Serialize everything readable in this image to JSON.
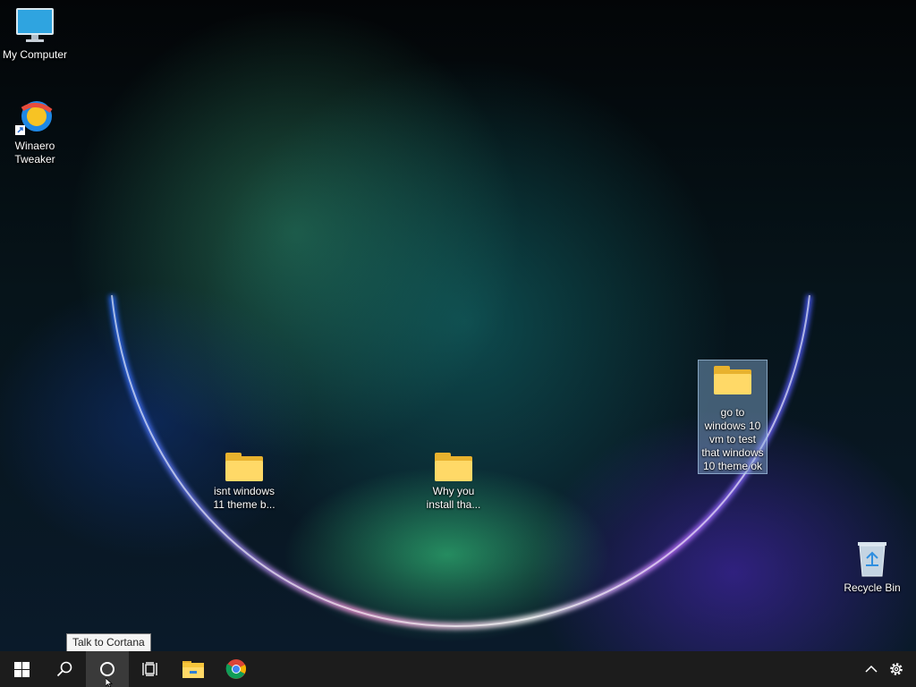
{
  "desktop": {
    "icons": [
      {
        "label": "My Computer"
      },
      {
        "label": "Winaero\nTweaker"
      },
      {
        "label": "isnt windows\n11 theme b..."
      },
      {
        "label": "Why you\ninstall tha..."
      },
      {
        "label": "go to\nwindows 10\nvm to test\nthat windows\n10 theme ok"
      },
      {
        "label": "Recycle Bin"
      }
    ]
  },
  "tooltip": {
    "text": "Talk to Cortana"
  },
  "taskbar": {
    "buttons": [
      {
        "icon": "windows-start-icon"
      },
      {
        "icon": "search-icon"
      },
      {
        "icon": "cortana-icon"
      },
      {
        "icon": "task-view-icon"
      },
      {
        "icon": "file-explorer-icon"
      },
      {
        "icon": "chrome-icon"
      }
    ],
    "tray": [
      {
        "icon": "chevron-up-icon"
      },
      {
        "icon": "settings-gear-icon"
      }
    ]
  }
}
